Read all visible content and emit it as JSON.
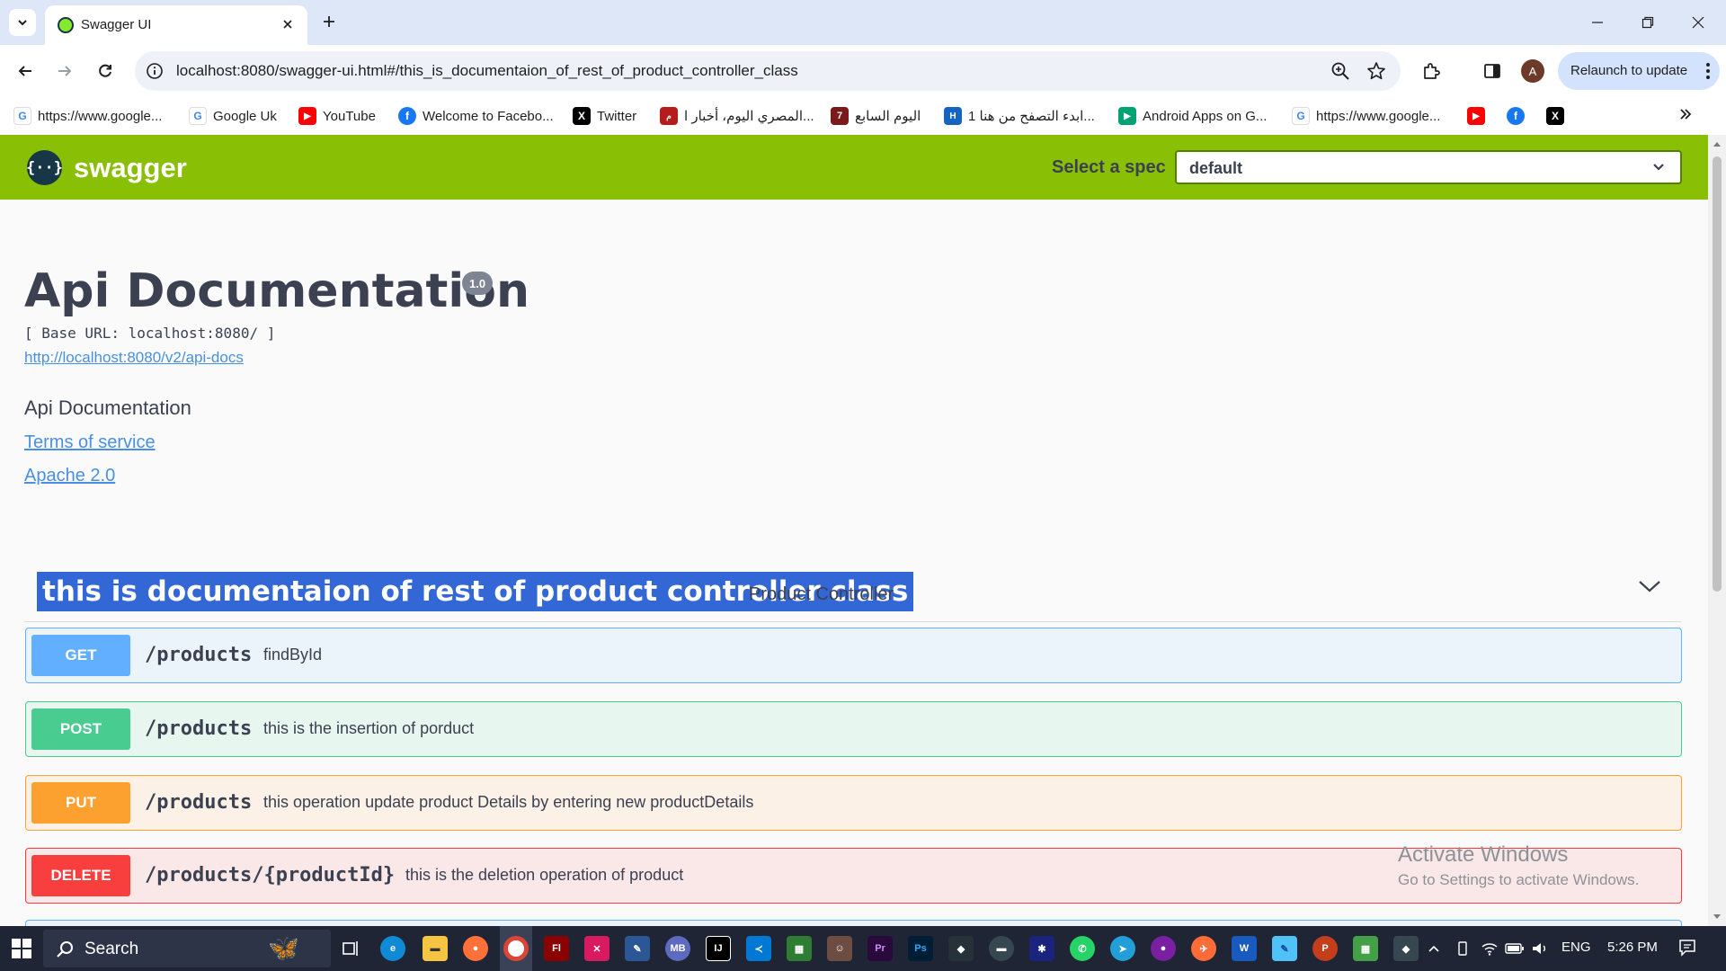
{
  "browser": {
    "tab_title": "Swagger UI",
    "url": "localhost:8080/swagger-ui.html#/this_is_documentaion_of_rest_of_product_controller_class",
    "profile_initial": "A",
    "relaunch_label": "Relaunch to update"
  },
  "bookmarks": [
    {
      "label": "https://www.google...",
      "icon": "google-icon",
      "color": "#4285f4"
    },
    {
      "label": "Google Uk",
      "icon": "google-icon",
      "color": "#4285f4"
    },
    {
      "label": "YouTube",
      "icon": "youtube-icon",
      "color": "#ff0000"
    },
    {
      "label": "Welcome to Facebo...",
      "icon": "facebook-icon",
      "color": "#1877f2"
    },
    {
      "label": "Twitter",
      "icon": "x-icon",
      "color": "#000000"
    },
    {
      "label": "المصري اليوم، أخبار ا...",
      "icon": "almasryalyoum-icon",
      "color": "#b71c1c"
    },
    {
      "label": "اليوم السابع",
      "icon": "youm7-icon",
      "color": "#7a1a1a"
    },
    {
      "label": "ابدء التصفح من هنا 1...",
      "icon": "hd-icon",
      "color": "#1565c0"
    },
    {
      "label": "Android Apps on G...",
      "icon": "google-play-icon",
      "color": "#00a173"
    },
    {
      "label": "https://www.google...",
      "icon": "google-icon",
      "color": "#4285f4"
    },
    {
      "label": "",
      "icon": "youtube-icon",
      "color": "#ff0000"
    },
    {
      "label": "",
      "icon": "facebook-icon",
      "color": "#1877f2"
    },
    {
      "label": "",
      "icon": "x-icon",
      "color": "#000000"
    }
  ],
  "swagger": {
    "logo_text": "swagger",
    "logo_mark": "{··}",
    "select_spec_label": "Select a spec",
    "select_spec_value": "default",
    "brand_color": "#89bf04"
  },
  "info": {
    "title": "Api Documentation",
    "version": "1.0",
    "base_url": "[ Base URL: localhost:8080/ ]",
    "docs_link": "http://localhost:8080/v2/api-docs",
    "description": "Api Documentation",
    "terms_link": "Terms of service",
    "license_link": "Apache 2.0"
  },
  "tag": {
    "name": "this is documentaion of rest of product controller class",
    "description": "Product Controller"
  },
  "operations": [
    {
      "method": "GET",
      "path": "/products",
      "summary": "findById",
      "color": "#61affe"
    },
    {
      "method": "POST",
      "path": "/products",
      "summary": "this is the insertion of porduct",
      "color": "#49cc90"
    },
    {
      "method": "PUT",
      "path": "/products",
      "summary": "this operation update product Details by entering new productDetails",
      "color": "#fca130"
    },
    {
      "method": "DELETE",
      "path": "/products/{productId}",
      "summary": "this is the deletion operation of product",
      "color": "#f93e3e"
    }
  ],
  "watermark": {
    "title": "Activate Windows",
    "subtitle": "Go to Settings to activate Windows."
  },
  "taskbar": {
    "search_placeholder": "Search",
    "language": "ENG",
    "time": "5:26 PM"
  }
}
